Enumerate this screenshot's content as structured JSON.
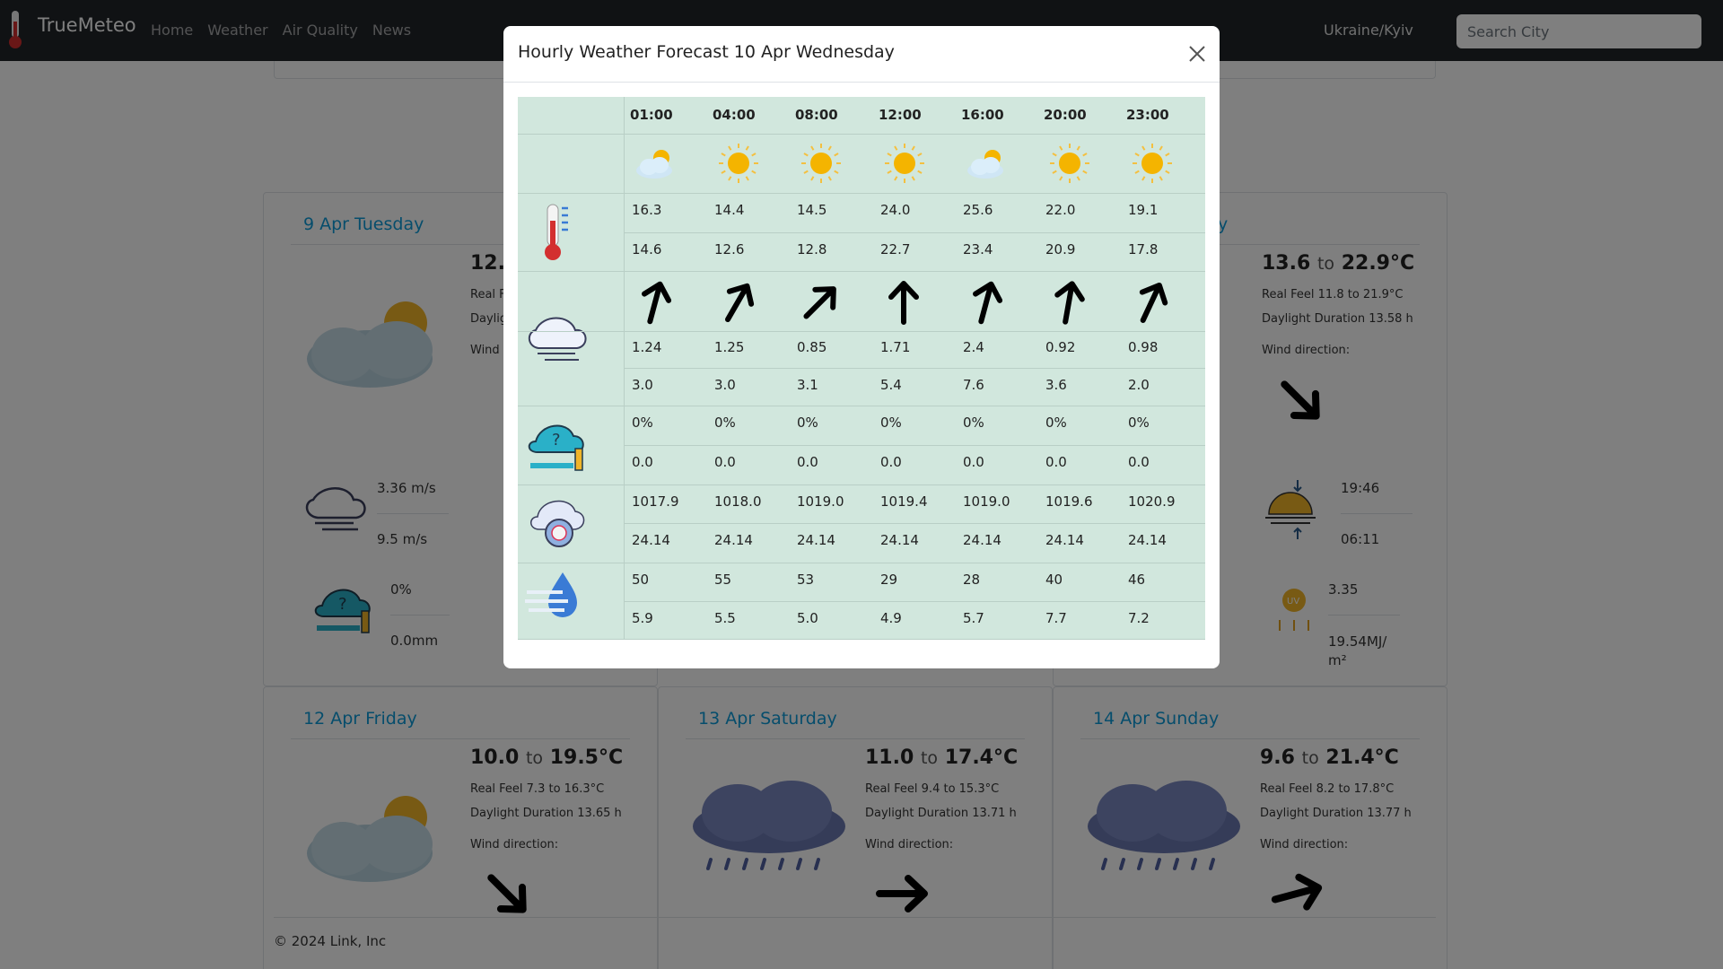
{
  "navbar": {
    "brand": "TrueMeteo",
    "links": [
      "Home",
      "Weather",
      "Air Quality",
      "News"
    ],
    "location": "Ukraine/Kyiv",
    "search_placeholder": "Search City"
  },
  "cards": {
    "c1": {
      "title": "9 Apr Tuesday",
      "temp_min": "12.",
      "real_feel": "Real F",
      "daylight": "Daylig",
      "wind_label": "Wind",
      "wind_speed": "3.36 m/s",
      "wind_gust": "9.5 m/s",
      "precip_prob": "0%",
      "precip": "0.0mm"
    },
    "c3": {
      "title": "y",
      "temp_min": "13.6",
      "temp_to": "to",
      "temp_max": "22.9°C",
      "real_feel": "Real Feel 11.8 to 21.9°C",
      "daylight": "Daylight Duration 13.58 h",
      "wind_label": "Wind direction:",
      "sunset": "19:46",
      "sunrise": "06:11",
      "uv": "3.35",
      "radiation": "19.54MJ/ m²",
      "partial_s": "s",
      "partial_h": "h"
    },
    "c4": {
      "title": "12 Apr Friday",
      "temp_min": "10.0",
      "temp_to": "to",
      "temp_max": "19.5°C",
      "real_feel": "Real Feel 7.3 to 16.3°C",
      "daylight": "Daylight Duration 13.65 h",
      "wind_label": "Wind direction:"
    },
    "c5": {
      "title": "13 Apr Saturday",
      "temp_min": "11.0",
      "temp_to": "to",
      "temp_max": "17.4°C",
      "real_feel": "Real Feel 9.4 to 15.3°C",
      "daylight": "Daylight Duration 13.71 h",
      "wind_label": "Wind direction:"
    },
    "c6": {
      "title": "14 Apr Sunday",
      "temp_min": "9.6",
      "temp_to": "to",
      "temp_max": "21.4°C",
      "real_feel": "Real Feel 8.2 to 17.8°C",
      "daylight": "Daylight Duration 13.77 h",
      "wind_label": "Wind direction:"
    }
  },
  "footer": "© 2024 Link, Inc",
  "modal": {
    "title": "Hourly Weather Forecast 10 Apr Wednesday",
    "hours": [
      "01:00",
      "04:00",
      "08:00",
      "12:00",
      "16:00",
      "20:00",
      "23:00"
    ],
    "conditions": [
      "partly-cloudy",
      "sunny",
      "sunny",
      "sunny",
      "partly-cloudy",
      "sunny",
      "sunny"
    ],
    "wind_dir_deg": [
      15,
      30,
      45,
      0,
      15,
      10,
      25
    ],
    "rows": [
      [
        "16.3",
        "14.4",
        "14.5",
        "24.0",
        "25.6",
        "22.0",
        "19.1"
      ],
      [
        "14.6",
        "12.6",
        "12.8",
        "22.7",
        "23.4",
        "20.9",
        "17.8"
      ],
      [
        "1.24",
        "1.25",
        "0.85",
        "1.71",
        "2.4",
        "0.92",
        "0.98"
      ],
      [
        "3.0",
        "3.0",
        "3.1",
        "5.4",
        "7.6",
        "3.6",
        "2.0"
      ],
      [
        "0%",
        "0%",
        "0%",
        "0%",
        "0%",
        "0%",
        "0%"
      ],
      [
        "0.0",
        "0.0",
        "0.0",
        "0.0",
        "0.0",
        "0.0",
        "0.0"
      ],
      [
        "1017.9",
        "1018.0",
        "1019.0",
        "1019.4",
        "1019.0",
        "1019.6",
        "1020.9"
      ],
      [
        "24.14",
        "24.14",
        "24.14",
        "24.14",
        "24.14",
        "24.14",
        "24.14"
      ],
      [
        "50",
        "55",
        "53",
        "29",
        "28",
        "40",
        "46"
      ],
      [
        "5.9",
        "5.5",
        "5.0",
        "4.9",
        "5.7",
        "7.7",
        "7.2"
      ]
    ]
  },
  "colors": {
    "navbar": "#212529",
    "accent": "#0d9bd8",
    "table_bg": "#d1e7dd"
  }
}
